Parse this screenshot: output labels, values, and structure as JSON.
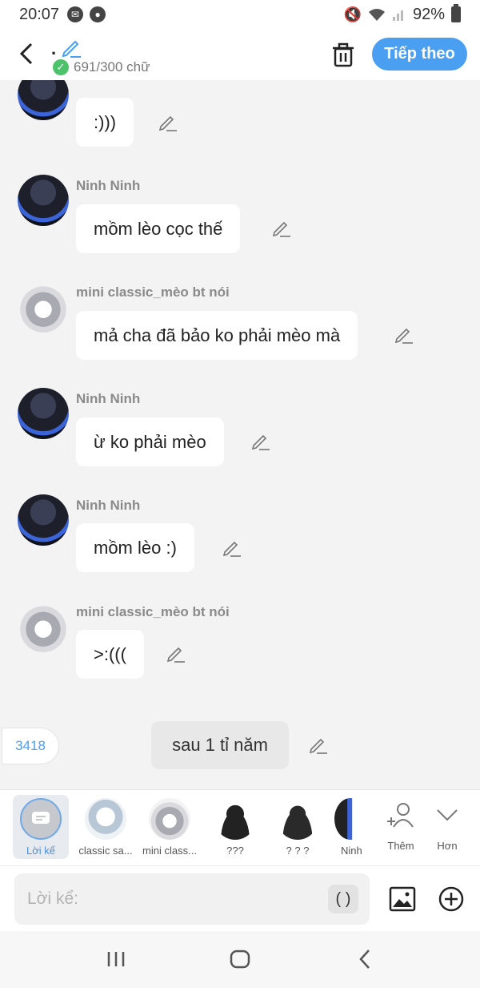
{
  "status": {
    "time": "20:07",
    "battery": "92%"
  },
  "header": {
    "title": ".",
    "char_count": "691/300 chữ",
    "next_label": "Tiếp theo",
    "accent": "#4a9ff0"
  },
  "messages": [
    {
      "sender": "Ninh Ninh",
      "text": ":)))"
    },
    {
      "sender": "Ninh Ninh",
      "text": "mồm lèo cọc thế"
    },
    {
      "sender": "mini classic_mèo bt nói",
      "text": "mả cha đã bảo ko phải mèo mà"
    },
    {
      "sender": "Ninh Ninh",
      "text": "ừ ko phải mèo"
    },
    {
      "sender": "Ninh Ninh",
      "text": "mồm lèo :)"
    },
    {
      "sender": "mini classic_mèo bt nói",
      "text": ">:((("
    }
  ],
  "narration": {
    "count": "3418",
    "text": "sau 1 tỉ năm"
  },
  "characters": [
    {
      "label": "Lời kể",
      "selected": true
    },
    {
      "label": "classic sa..."
    },
    {
      "label": "mini class..."
    },
    {
      "label": "???"
    },
    {
      "label": "? ? ?"
    },
    {
      "label": "Ninh"
    },
    {
      "label": "Thêm"
    },
    {
      "label": "Hơn"
    }
  ],
  "input": {
    "placeholder": "Lời kể:",
    "paren": "( )"
  }
}
